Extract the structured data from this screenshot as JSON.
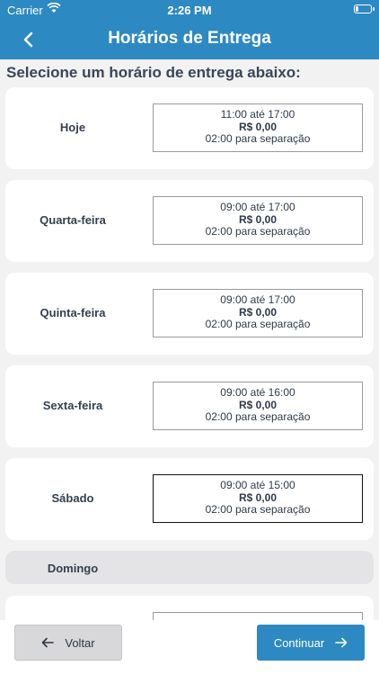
{
  "status_bar": {
    "carrier": "Carrier",
    "time": "2:26 PM"
  },
  "nav": {
    "title": "Horários de Entrega",
    "back_icon": "chevron-left-icon"
  },
  "heading": "Selecione um horário de entrega abaixo:",
  "days": [
    {
      "label": "Hoje",
      "time": "11:00 até 17:00",
      "price": "R$ 0,00",
      "sep": "02:00 para separação",
      "selected": false
    },
    {
      "label": "Quarta-feira",
      "time": "09:00 até 17:00",
      "price": "R$ 0,00",
      "sep": "02:00 para separação",
      "selected": false
    },
    {
      "label": "Quinta-feira",
      "time": "09:00 até 17:00",
      "price": "R$ 0,00",
      "sep": "02:00 para separação",
      "selected": false
    },
    {
      "label": "Sexta-feira",
      "time": "09:00 até 16:00",
      "price": "R$ 0,00",
      "sep": "02:00 para separação",
      "selected": false
    },
    {
      "label": "Sábado",
      "time": "09:00 até 15:00",
      "price": "R$ 0,00",
      "sep": "02:00 para separação",
      "selected": true
    }
  ],
  "disabled_day": {
    "label": "Domingo"
  },
  "buttons": {
    "back_label": "Voltar",
    "next_label": "Continuar"
  },
  "colors": {
    "primary": "#2d89c1",
    "background": "#f2f2f3",
    "text_dark": "#3a4556"
  }
}
